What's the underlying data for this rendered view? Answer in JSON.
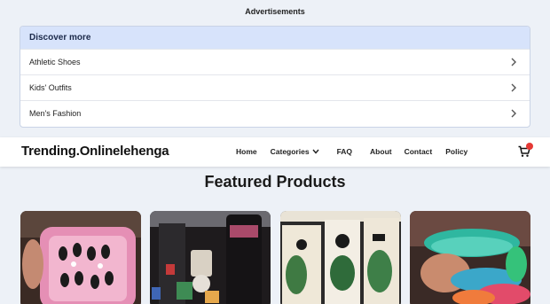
{
  "ads": {
    "label": "Advertisements"
  },
  "discover": {
    "title": "Discover more",
    "items": [
      {
        "label": "Athletic Shoes"
      },
      {
        "label": "Kids' Outfits"
      },
      {
        "label": "Men's Fashion"
      }
    ]
  },
  "header": {
    "logo": "Trending.Onlinelehenga",
    "nav": {
      "home": "Home",
      "categories": "Categories",
      "faq": "FAQ",
      "about": "About",
      "contact": "Contact",
      "policy": "Policy"
    },
    "cart_icon": "cart-icon",
    "badge_color": "#e53935"
  },
  "featured": {
    "title": "Featured Products"
  },
  "colors": {
    "page_bg": "#edf1f7",
    "discover_head": "#d7e3fb"
  }
}
